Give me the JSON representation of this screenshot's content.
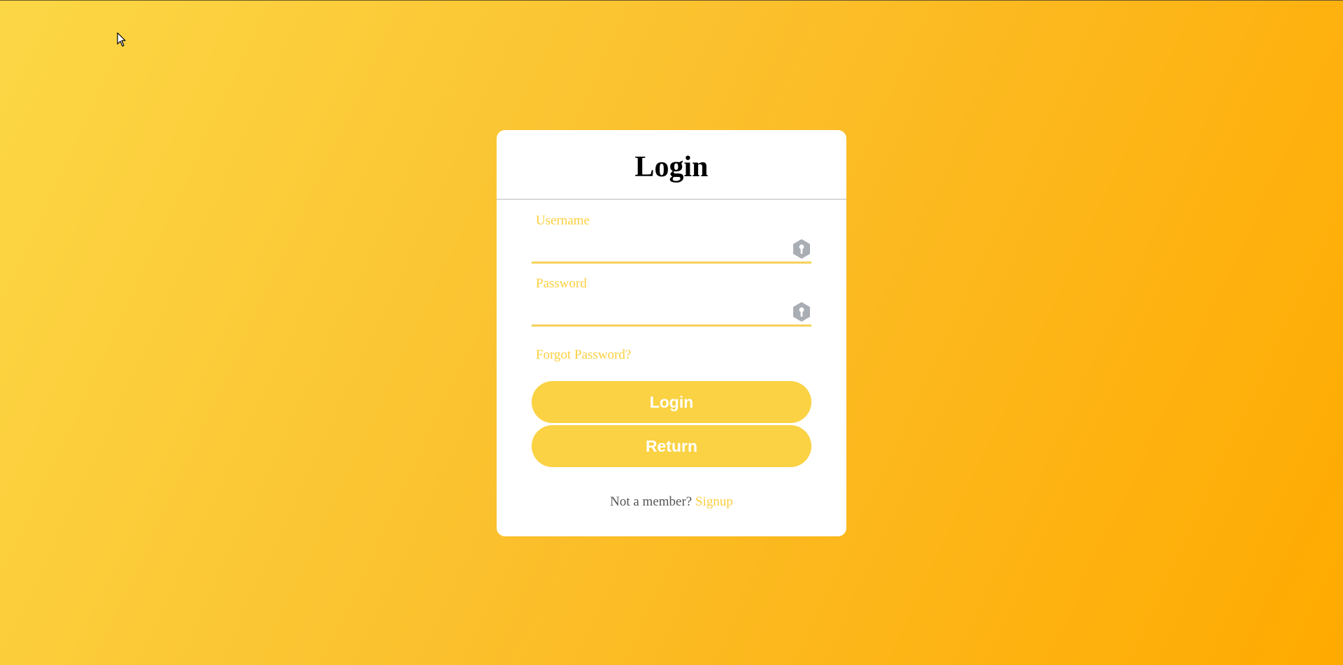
{
  "login_card": {
    "title": "Login",
    "username": {
      "label": "Username",
      "value": "",
      "icon": "key-hexagon-icon"
    },
    "password": {
      "label": "Password",
      "value": "",
      "icon": "key-hexagon-icon"
    },
    "forgot_password": "Forgot Password?",
    "login_button": "Login",
    "return_button": "Return",
    "signup_prompt": "Not a member?",
    "signup_link": "Signup"
  },
  "colors": {
    "background_start": "#fcd745",
    "background_end": "#ffaa00",
    "accent": "#fad243",
    "label": "#fbcf3e",
    "icon": "#a9adb4"
  }
}
